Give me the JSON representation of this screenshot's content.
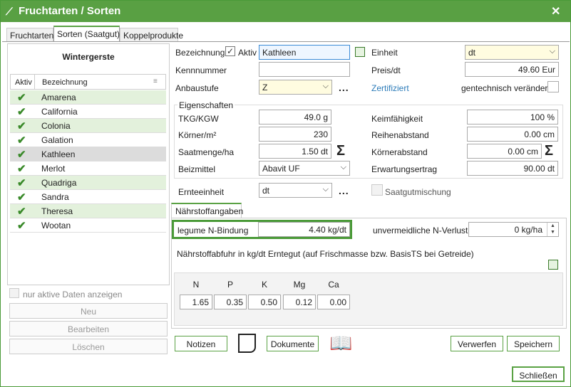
{
  "window": {
    "title": "Fruchtarten / Sorten",
    "close": "✕"
  },
  "tabs": [
    "Fruchtarten",
    "Sorten (Saatgut)",
    "Koppelprodukte"
  ],
  "left": {
    "heading": "Wintergerste",
    "col_aktiv": "Aktiv",
    "col_bez": "Bezeichnung",
    "items": [
      {
        "name": "Amarena",
        "aktiv": true
      },
      {
        "name": "California",
        "aktiv": true
      },
      {
        "name": "Colonia",
        "aktiv": true
      },
      {
        "name": "Galation",
        "aktiv": true
      },
      {
        "name": "Kathleen",
        "aktiv": true
      },
      {
        "name": "Merlot",
        "aktiv": true
      },
      {
        "name": "Quadriga",
        "aktiv": true
      },
      {
        "name": "Sandra",
        "aktiv": true
      },
      {
        "name": "Theresa",
        "aktiv": true
      },
      {
        "name": "Wootan",
        "aktiv": true
      }
    ],
    "only_active": "nur aktive Daten anzeigen",
    "btn_new": "Neu",
    "btn_edit": "Bearbeiten",
    "btn_delete": "Löschen"
  },
  "form": {
    "bezeichnung_label": "Bezeichnung",
    "aktiv_label": "Aktiv",
    "bezeichnung_value": "Kathleen",
    "kennnummer_label": "Kennnummer",
    "kennnummer_value": "",
    "anbaustufe_label": "Anbaustufe",
    "anbaustufe_value": "Z",
    "einheit_label": "Einheit",
    "einheit_value": "dt",
    "preis_label": "Preis/dt",
    "preis_value": "49.60 Eur",
    "zertifiziert": "Zertifiziert",
    "gentech_label": "gentechnisch verändert",
    "eigenschaften": "Eigenschaften",
    "tkg_label": "TKG/KGW",
    "tkg_value": "49.0 g",
    "koerner_label": "Körner/m²",
    "koerner_value": "230",
    "saatmenge_label": "Saatmenge/ha",
    "saatmenge_value": "1.50 dt",
    "beizmittel_label": "Beizmittel",
    "beizmittel_value": "Abavit UF",
    "keim_label": "Keimfähigkeit",
    "keim_value": "100 %",
    "reihen_label": "Reihenabstand",
    "reihen_value": "0.00 cm",
    "koernerab_label": "Körnerabstand",
    "koernerab_value": "0.00 cm",
    "erwartung_label": "Erwartungsertrag",
    "erwartung_value": "90.00 dt",
    "ernte_label": "Ernteeinheit",
    "ernte_value": "dt",
    "saatgutmischung": "Saatgutmischung"
  },
  "naehrstoff": {
    "tab": "Nährstoffangaben",
    "legume_label": "legume N-Bindung",
    "legume_value": "4.40 kg/dt",
    "verluste_label": "unvermeidliche N-Verluste",
    "verluste_value": "0 kg/ha",
    "abfuhr_text": "Nährstoffabfuhr in kg/dt Erntegut (auf Frischmasse bzw. BasisTS bei Getreide)",
    "cols": [
      "N",
      "P",
      "K",
      "Mg",
      "Ca"
    ],
    "vals": [
      "1.65",
      "0.35",
      "0.50",
      "0.12",
      "0.00"
    ]
  },
  "buttons": {
    "notizen": "Notizen",
    "dokumente": "Dokumente",
    "verwerfen": "Verwerfen",
    "speichern": "Speichern",
    "schliessen": "Schließen"
  }
}
